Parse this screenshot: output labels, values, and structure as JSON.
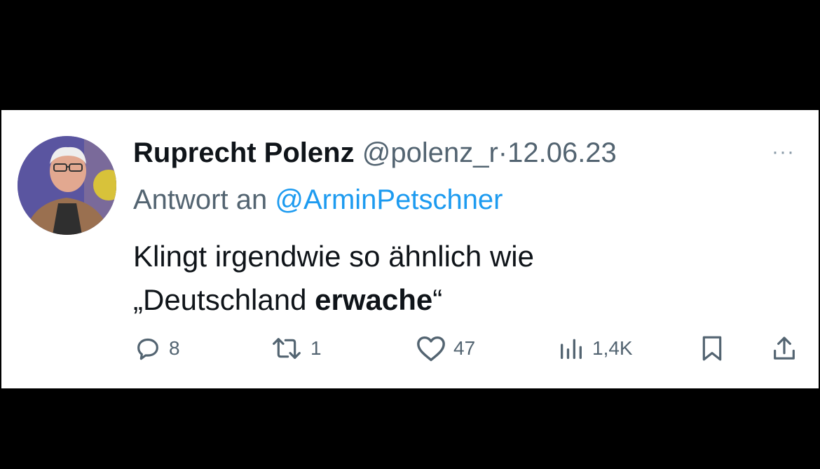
{
  "tweet": {
    "author_name": "Ruprecht Polenz",
    "author_handle": "@polenz_r",
    "separator": "·",
    "date": "12.06.23",
    "more_label": "···",
    "reply_prefix": "Antwort an",
    "reply_mention": "@ArminPetschner",
    "text_line1": "Klingt irgendwie so ähnlich wie",
    "text_line2_prefix": "„Deutschland ",
    "text_line2_bold": "erwache",
    "text_line2_suffix": "“"
  },
  "actions": {
    "replies": "8",
    "retweets": "1",
    "likes": "47",
    "views": "1,4K"
  },
  "colors": {
    "background": "#000000",
    "card": "#ffffff",
    "text": "#0f1419",
    "secondary": "#536471",
    "link": "#1d9bf0"
  },
  "icons": [
    "reply-icon",
    "retweet-icon",
    "like-icon",
    "views-icon",
    "bookmark-icon",
    "share-icon",
    "more-icon"
  ]
}
